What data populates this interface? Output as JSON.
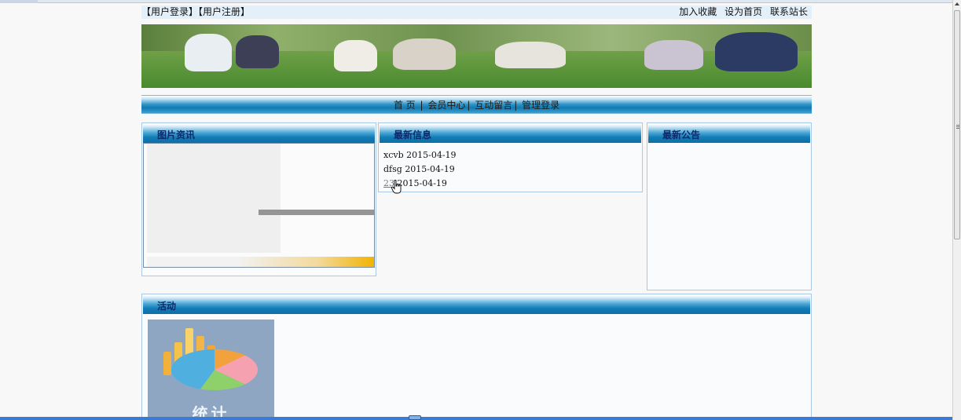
{
  "header": {
    "login": "【用户登录】",
    "register": "【用户注册】",
    "favorite": "加入收藏",
    "homepage": "设为首页",
    "contact": "联系站长"
  },
  "nav": {
    "items": [
      "首 页",
      "会员中心",
      "互动留言",
      "管理登录"
    ],
    "separator": "|"
  },
  "panels": {
    "pictures": {
      "title": "图片资讯"
    },
    "news": {
      "title": "最新信息",
      "items": [
        {
          "title": "xcvb",
          "date": "2015-04-19"
        },
        {
          "title": "dfsg",
          "date": "2015-04-19"
        },
        {
          "title": "23",
          "date": "2015-04-19"
        }
      ]
    },
    "notice": {
      "title": "最新公告"
    },
    "activity": {
      "title": "活动",
      "thumb_caption": "统计"
    }
  },
  "colors": {
    "panel_header": "#137cb6",
    "panel_title": "#0a2a6a",
    "topbar_bg": "#e3f0fa"
  }
}
